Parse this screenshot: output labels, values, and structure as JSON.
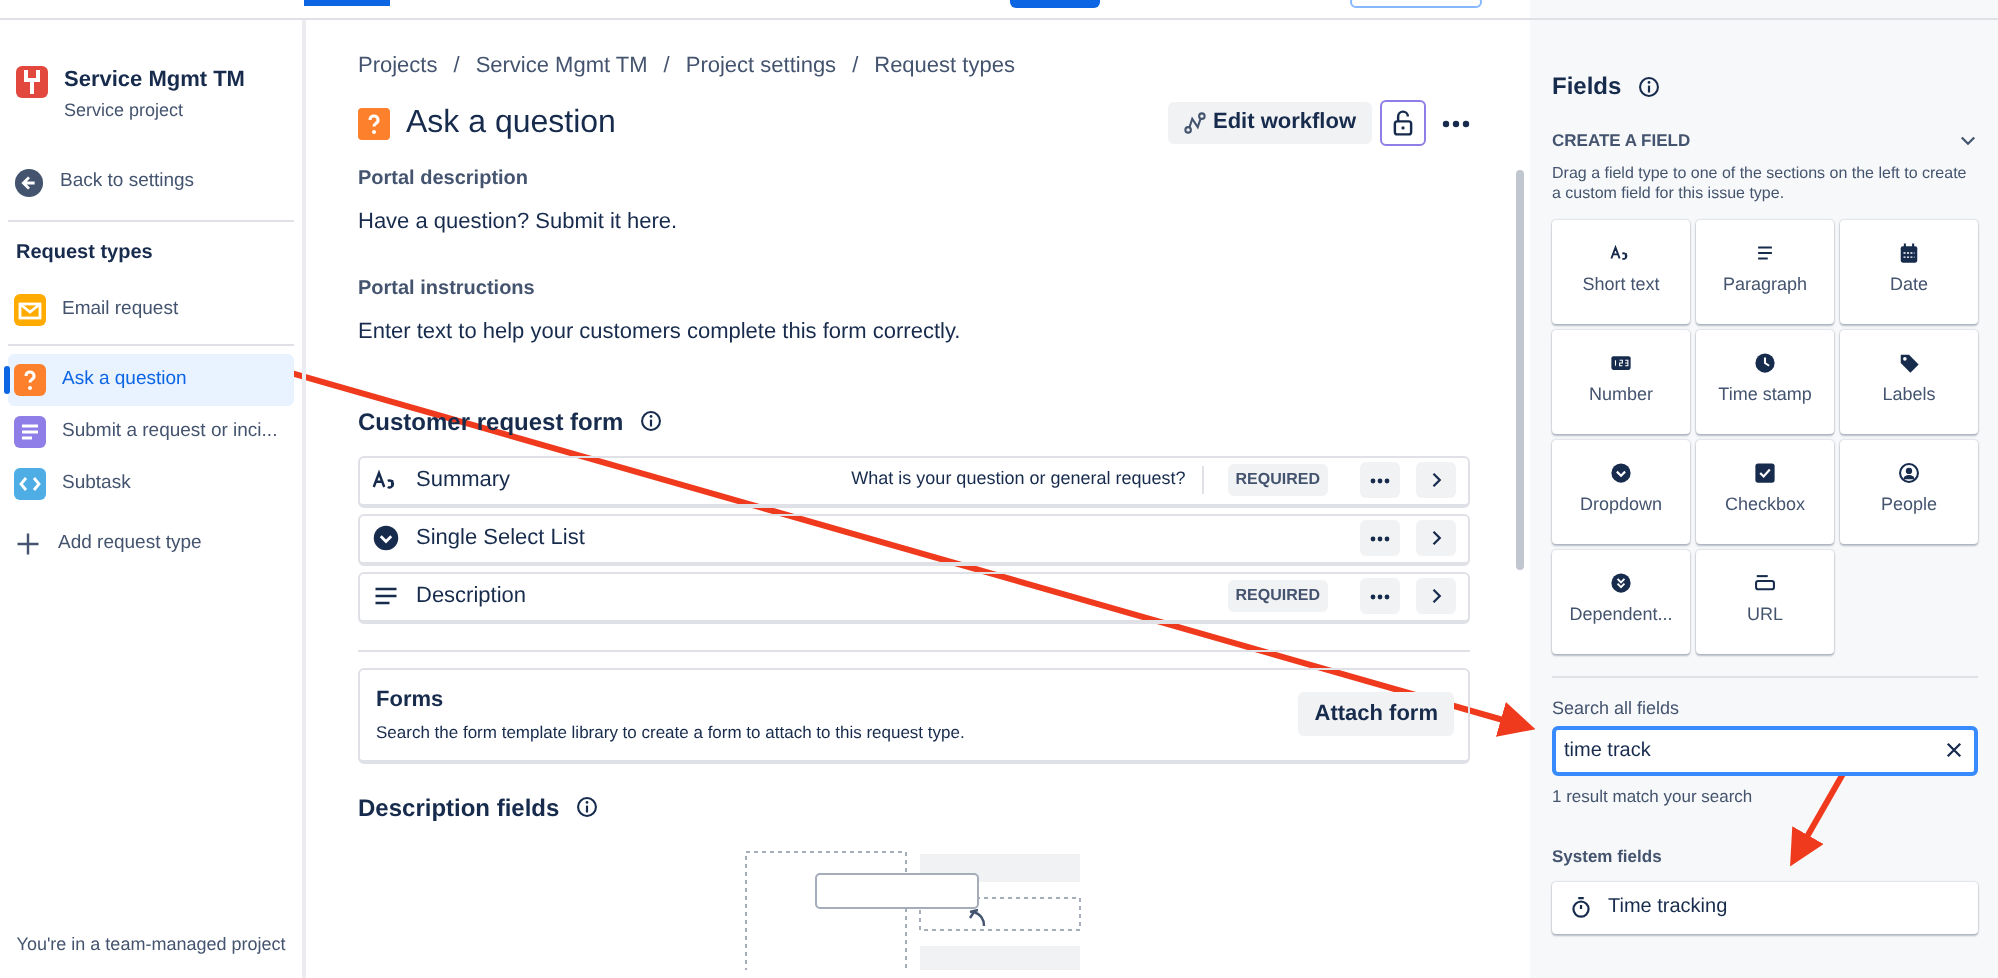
{
  "project": {
    "name": "Service Mgmt TM",
    "type": "Service project"
  },
  "back_link": "Back to settings",
  "sidebar": {
    "heading": "Request types",
    "items": [
      {
        "label": "Email request",
        "kind": "email",
        "selected": false
      },
      {
        "label": "Ask a question",
        "kind": "question",
        "selected": true
      },
      {
        "label": "Submit a request or inci...",
        "kind": "form",
        "selected": false
      },
      {
        "label": "Subtask",
        "kind": "code",
        "selected": false
      }
    ],
    "add_label": "Add request type",
    "footer": "You're in a team-managed project"
  },
  "breadcrumbs": [
    "Projects",
    "Service Mgmt TM",
    "Project settings",
    "Request types"
  ],
  "breadcrumb_separator": "/",
  "page": {
    "title": "Ask a question",
    "edit_workflow": "Edit workflow",
    "locked": false,
    "portal_description_label": "Portal description",
    "portal_description": "Have a question? Submit it here.",
    "portal_instructions_label": "Portal instructions",
    "portal_instructions": "Enter text to help your customers complete this form correctly."
  },
  "form": {
    "title": "Customer request form",
    "fields": [
      {
        "kind": "short-text",
        "label": "Summary",
        "hint": "What is your question or general request?",
        "badge": "REQUIRED"
      },
      {
        "kind": "select",
        "label": "Single Select List"
      },
      {
        "kind": "paragraph",
        "label": "Description",
        "badge": "REQUIRED"
      }
    ]
  },
  "forms_box": {
    "title": "Forms",
    "text": "Search the form template library to create a form to attach to this request type.",
    "button": "Attach form"
  },
  "description_fields": {
    "title": "Description fields"
  },
  "fields_panel": {
    "title": "Fields",
    "section": "CREATE A FIELD",
    "expanded": true,
    "help": "Drag a field type to one of the sections on the left to create a custom field for this issue type.",
    "types": [
      {
        "kind": "text",
        "label": "Short text"
      },
      {
        "kind": "paragraph",
        "label": "Paragraph"
      },
      {
        "kind": "date",
        "label": "Date"
      },
      {
        "kind": "number",
        "label": "Number"
      },
      {
        "kind": "clock",
        "label": "Time stamp"
      },
      {
        "kind": "tag",
        "label": "Labels"
      },
      {
        "kind": "dropdown",
        "label": "Dropdown"
      },
      {
        "kind": "checkbox",
        "label": "Checkbox"
      },
      {
        "kind": "person",
        "label": "People"
      },
      {
        "kind": "dependent",
        "label": "Dependent..."
      },
      {
        "kind": "url",
        "label": "URL"
      }
    ],
    "search": {
      "label": "Search all fields",
      "value": "time track"
    },
    "result_count": "1 result match your search",
    "system_heading": "System fields",
    "results": [
      {
        "label": "Time tracking"
      }
    ]
  }
}
